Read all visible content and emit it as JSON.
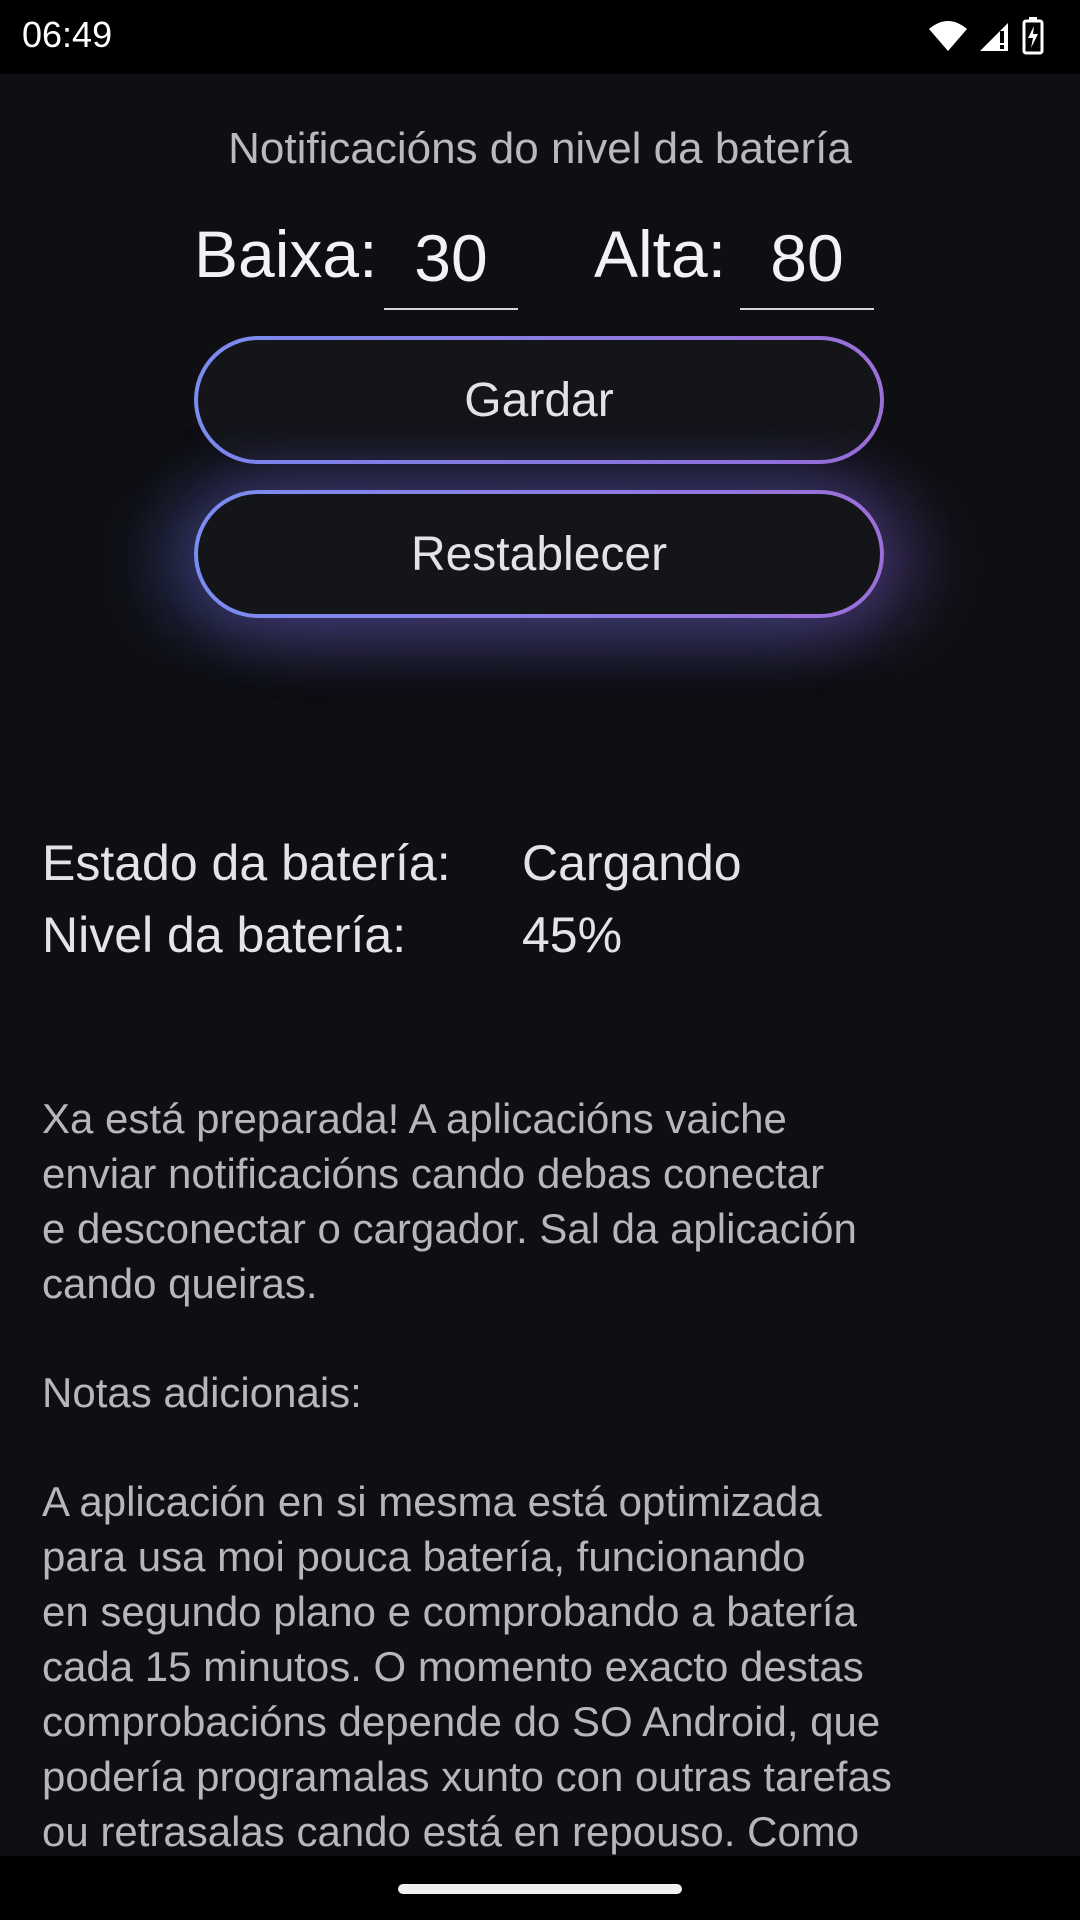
{
  "status_bar": {
    "time": "06:49",
    "icons": [
      "wifi-icon",
      "signal-icon",
      "battery-charging-icon"
    ]
  },
  "settings": {
    "title": "Notificacións do nivel da batería",
    "low_label": "Baixa:",
    "low_value": "30",
    "high_label": "Alta:",
    "high_value": "80"
  },
  "buttons": {
    "save_label": "Gardar",
    "reset_label": "Restablecer"
  },
  "battery": {
    "state_label": "Estado da batería:",
    "state_value": "Cargando",
    "level_label": "Nivel da batería:",
    "level_value": "45%"
  },
  "info": {
    "ready_text": "Xa está preparada! A aplicacións vaiche\nenviar notificacións cando debas conectar\ne desconectar o cargador. Sal da aplicación\ncando queiras.",
    "notes_heading": "Notas adicionais:",
    "notes_text": "A aplicación en si mesma está optimizada\npara usa moi pouca batería, funcionando\nen segundo plano e comprobando a batería\ncada 15 minutos. O momento exacto destas\ncomprobacións depende do SO Android, que\npodería programalas xunto con outras tarefas\nou retrasalas cando está en repouso. Como"
  },
  "colors": {
    "background": "#0e0f12",
    "button_gradient_start": "#7b8cf0",
    "button_gradient_end": "#9b6fd8"
  }
}
